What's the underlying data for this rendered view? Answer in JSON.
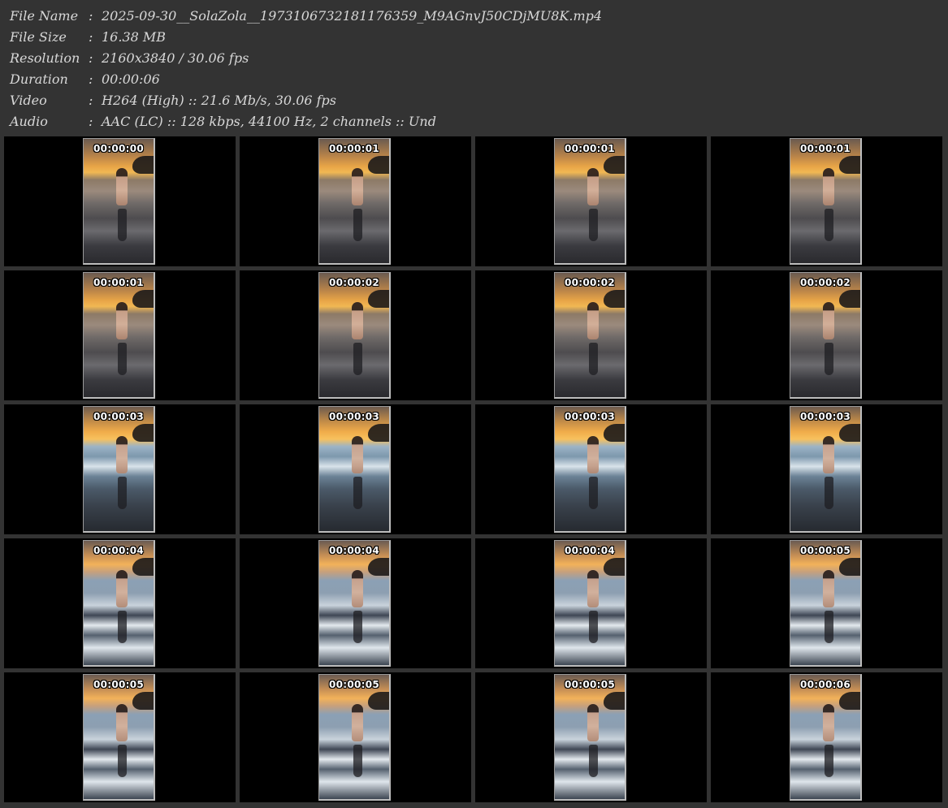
{
  "file_info": [
    {
      "label": "File Name",
      "value": "2025-09-30__SolaZola__1973106732181176359_M9AGnvJ50CDjMU8K.mp4"
    },
    {
      "label": "File Size",
      "value": "16.38 MB"
    },
    {
      "label": "Resolution",
      "value": "2160x3840 / 30.06 fps"
    },
    {
      "label": "Duration",
      "value": "00:00:06"
    },
    {
      "label": "Video",
      "value": "H264 (High) :: 21.6 Mb/s, 30.06 fps"
    },
    {
      "label": "Audio",
      "value": "AAC (LC) :: 128 kbps, 44100 Hz, 2 channels :: Und"
    }
  ],
  "separator": ":",
  "thumbnails": [
    {
      "time": "00:00:00",
      "scene": "sunset"
    },
    {
      "time": "00:00:01",
      "scene": "sunset"
    },
    {
      "time": "00:00:01",
      "scene": "sunset"
    },
    {
      "time": "00:00:01",
      "scene": "sunset"
    },
    {
      "time": "00:00:01",
      "scene": "sunset"
    },
    {
      "time": "00:00:02",
      "scene": "sunset"
    },
    {
      "time": "00:00:02",
      "scene": "sunset"
    },
    {
      "time": "00:00:02",
      "scene": "sunset"
    },
    {
      "time": "00:00:03",
      "scene": "wave"
    },
    {
      "time": "00:00:03",
      "scene": "wave"
    },
    {
      "time": "00:00:03",
      "scene": "wave"
    },
    {
      "time": "00:00:03",
      "scene": "wave"
    },
    {
      "time": "00:00:04",
      "scene": "foam"
    },
    {
      "time": "00:00:04",
      "scene": "foam"
    },
    {
      "time": "00:00:04",
      "scene": "foam"
    },
    {
      "time": "00:00:05",
      "scene": "foam"
    },
    {
      "time": "00:00:05",
      "scene": "foam"
    },
    {
      "time": "00:00:05",
      "scene": "foam"
    },
    {
      "time": "00:00:05",
      "scene": "foam"
    },
    {
      "time": "00:00:06",
      "scene": "foam"
    }
  ],
  "colors": {
    "background": "#333333",
    "cell_background": "#000000",
    "info_text": "#d8d8d8",
    "timestamp_text": "#ffffff"
  }
}
